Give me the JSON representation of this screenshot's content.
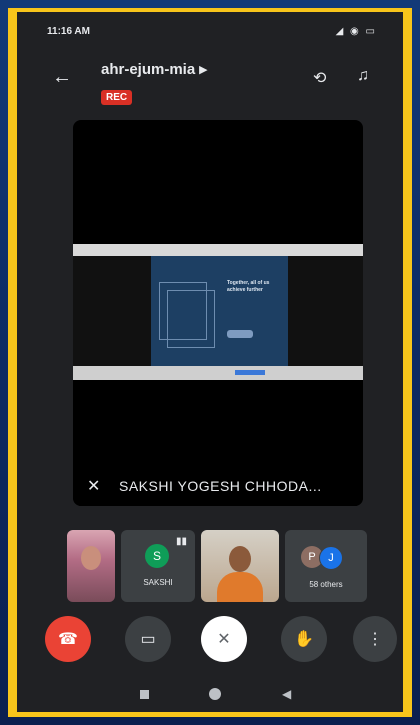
{
  "status_bar": {
    "time": "11:16 AM",
    "icons": "◢ ◉ ▭"
  },
  "header": {
    "meeting_code": "ahr-ejum-mia ▸",
    "rec_badge": "REC"
  },
  "icons": {
    "back": "←",
    "switch_camera": "⟲",
    "audio": "♫",
    "mic_off": "✕",
    "speaking": "▮▮",
    "end_call": "☎",
    "camera": "▭",
    "mic": "✕",
    "raise_hand": "✋",
    "more": "⋮",
    "nav_back": "◀"
  },
  "main_tile": {
    "participant_name": "SAKSHI YOGESH CHHODA...",
    "slide_text": "Together, all of us achieve further"
  },
  "participants": {
    "sakshi": {
      "initial": "S",
      "label": "SAKSHI"
    },
    "others": {
      "initial_1": "P",
      "initial_2": "J",
      "label": "58 others"
    }
  },
  "colors": {
    "frame": "#f7c51b",
    "screen_bg": "#202124",
    "rec": "#d93025",
    "end_call": "#ea4335"
  }
}
